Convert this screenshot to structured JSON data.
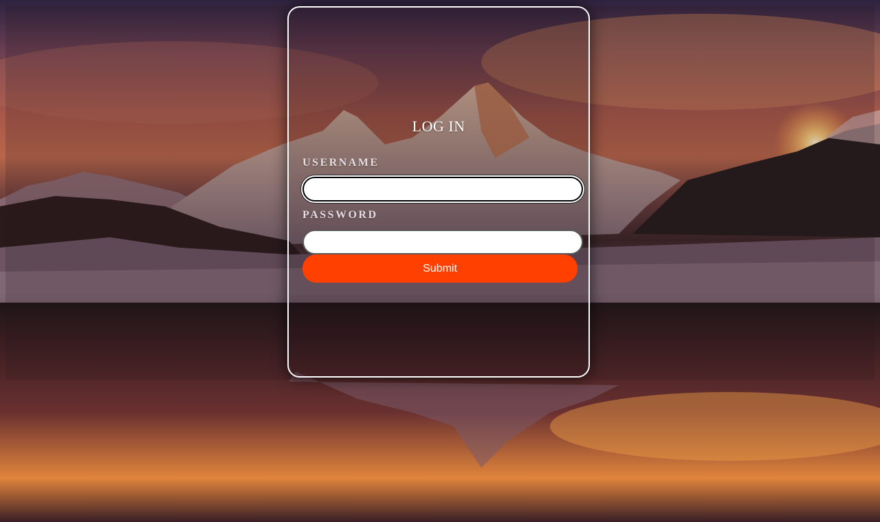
{
  "login": {
    "title": "LOG IN",
    "username_label": "USERNAME",
    "username_value": "",
    "password_label": "PASSWORD",
    "password_value": "",
    "submit_label": "Submit"
  },
  "colors": {
    "accent": "#ff4000",
    "card_border": "#ffffff"
  }
}
